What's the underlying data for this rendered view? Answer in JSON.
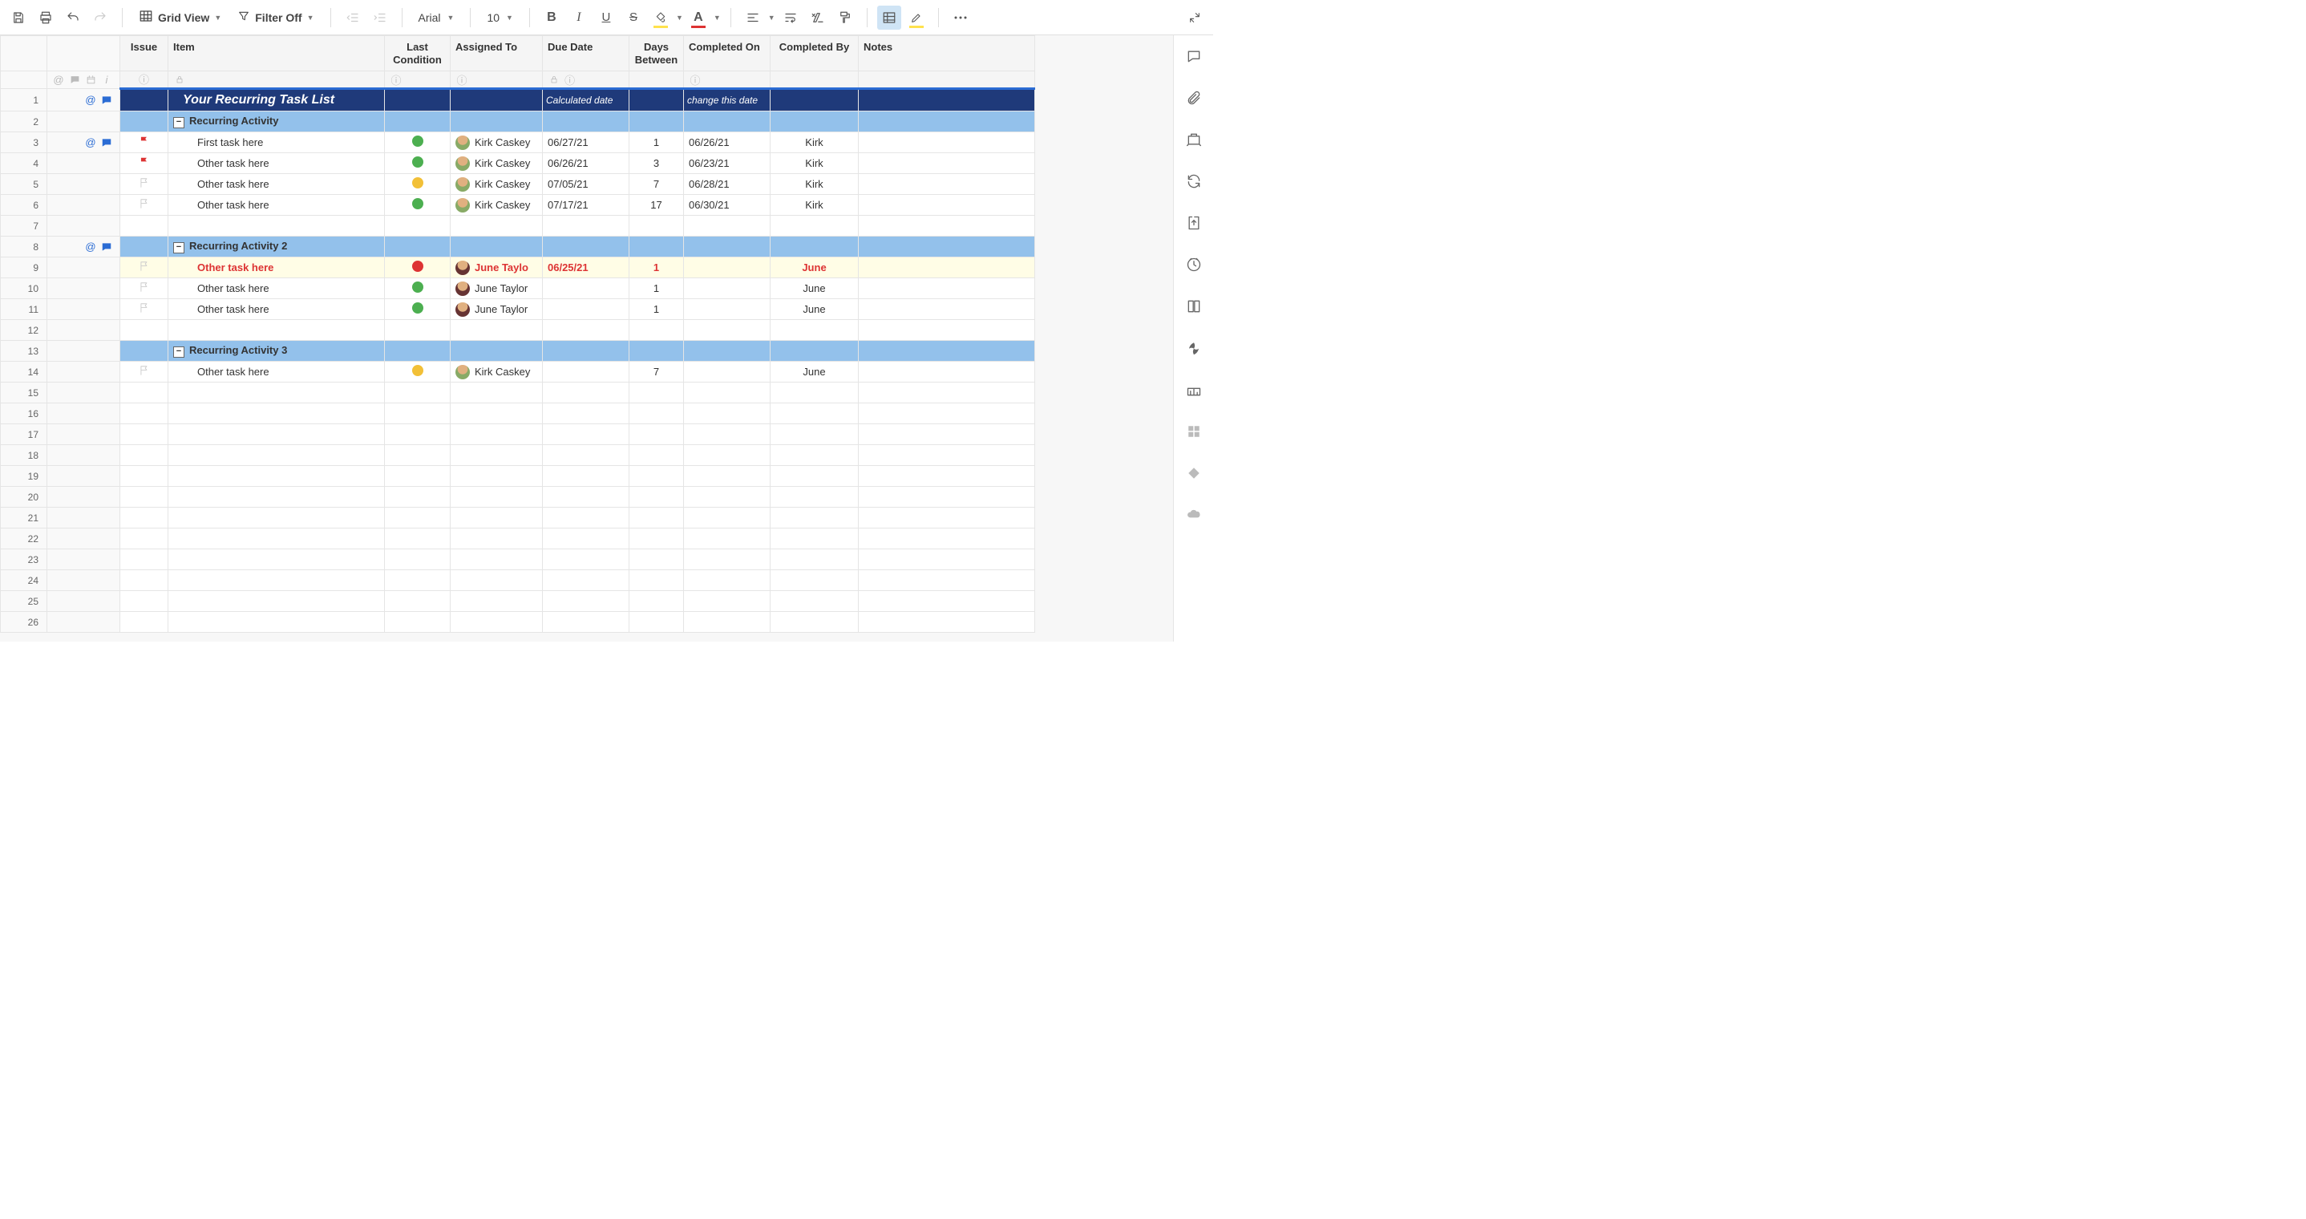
{
  "toolbar": {
    "view_label": "Grid View",
    "filter_label": "Filter Off",
    "font_family": "Arial",
    "font_size": "10"
  },
  "columns": {
    "issue": "Issue",
    "item": "Item",
    "last_condition": "Last Condition",
    "assigned_to": "Assigned To",
    "due_date": "Due Date",
    "days_between": "Days Between",
    "completed_on": "Completed On",
    "completed_by": "Completed By",
    "notes": "Notes"
  },
  "title_row": {
    "item": "Your Recurring Task List",
    "due_hint": "Calculated date",
    "completed_hint": "change this date"
  },
  "sections": [
    {
      "row": 2,
      "label": "Recurring Activity",
      "tasks": [
        {
          "row": 3,
          "flag": "red",
          "item": "First task here",
          "cond": "green",
          "assignee": "Kirk Caskey",
          "avatar": "kirk",
          "due": "06/27/21",
          "days": "1",
          "completed_on": "06/26/21",
          "completed_by": "Kirk",
          "attach": true,
          "comment": true
        },
        {
          "row": 4,
          "flag": "red",
          "item": "Other task here",
          "cond": "green",
          "assignee": "Kirk Caskey",
          "avatar": "kirk",
          "due": "06/26/21",
          "days": "3",
          "completed_on": "06/23/21",
          "completed_by": "Kirk"
        },
        {
          "row": 5,
          "flag": "empty",
          "item": "Other task here",
          "cond": "yellow",
          "assignee": "Kirk Caskey",
          "avatar": "kirk",
          "due": "07/05/21",
          "days": "7",
          "completed_on": "06/28/21",
          "completed_by": "Kirk"
        },
        {
          "row": 6,
          "flag": "empty",
          "item": "Other task here",
          "cond": "green",
          "assignee": "Kirk Caskey",
          "avatar": "kirk",
          "due": "07/17/21",
          "days": "17",
          "completed_on": "06/30/21",
          "completed_by": "Kirk"
        }
      ]
    },
    {
      "row": 8,
      "label": "Recurring Activity 2",
      "attach": true,
      "comment": true,
      "tasks": [
        {
          "row": 9,
          "flag": "empty",
          "item": "Other task here",
          "cond": "red",
          "assignee": "June Taylo",
          "avatar": "june",
          "due": "06/25/21",
          "days": "1",
          "completed_on": "",
          "completed_by": "June",
          "overdue": true
        },
        {
          "row": 10,
          "flag": "empty",
          "item": "Other task here",
          "cond": "green",
          "assignee": "June Taylor",
          "avatar": "june",
          "due": "",
          "days": "1",
          "completed_on": "",
          "completed_by": "June"
        },
        {
          "row": 11,
          "flag": "empty",
          "item": "Other task here",
          "cond": "green",
          "assignee": "June Taylor",
          "avatar": "june",
          "due": "",
          "days": "1",
          "completed_on": "",
          "completed_by": "June"
        }
      ]
    },
    {
      "row": 13,
      "label": "Recurring Activity 3",
      "tasks": [
        {
          "row": 14,
          "flag": "empty",
          "item": "Other task here",
          "cond": "yellow",
          "assignee": "Kirk Caskey",
          "avatar": "kirk",
          "due": "",
          "days": "7",
          "completed_on": "",
          "completed_by": "June"
        }
      ]
    }
  ],
  "blank_rows_after_section1": [
    7
  ],
  "blank_rows_after_section2": [
    12
  ],
  "trailing_blank_rows": [
    15,
    16,
    17,
    18,
    19,
    20,
    21,
    22,
    23,
    24,
    25,
    26
  ]
}
